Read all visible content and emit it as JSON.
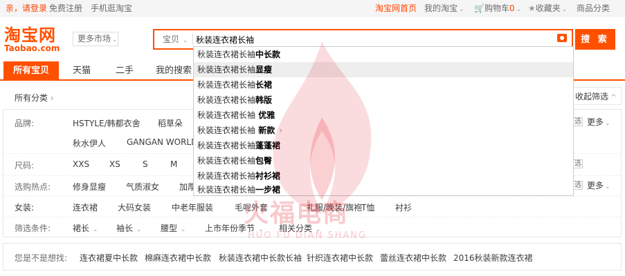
{
  "topbar": {
    "greeting": "亲，请登录",
    "register": "免费注册",
    "mobile": "手机逛淘宝",
    "home": "淘宝网首页",
    "my_taobao": "我的淘宝",
    "cart": "购物车",
    "cart_count": "0",
    "favorites": "收藏夹",
    "categories": "商品分类"
  },
  "logo": {
    "cn": "淘宝网",
    "en": "Taobao.com"
  },
  "more_market": "更多市场",
  "search": {
    "scope": "宝贝",
    "value": "秋装连衣裙长袖",
    "button": "搜 索"
  },
  "suggestions": [
    {
      "prefix": "秋装连衣裙长袖",
      "suffix": "中长款",
      "arrow": false
    },
    {
      "prefix": "秋装连衣裙长袖",
      "suffix": "显瘦",
      "arrow": false
    },
    {
      "prefix": "秋装连衣裙长袖",
      "suffix": "长裙",
      "arrow": false
    },
    {
      "prefix": "秋装连衣裙长袖",
      "suffix": "韩版",
      "arrow": false
    },
    {
      "prefix": "秋装连衣裙长袖",
      "suffix": " 优雅",
      "arrow": false
    },
    {
      "prefix": "秋装连衣裙长袖",
      "suffix": " 新款",
      "arrow": true
    },
    {
      "prefix": "秋装连衣裙长袖",
      "suffix": "蓬蓬裙",
      "arrow": false
    },
    {
      "prefix": "秋装连衣裙长袖",
      "suffix": "包臀",
      "arrow": false
    },
    {
      "prefix": "秋装连衣裙长袖",
      "suffix": "衬衫裙",
      "arrow": false
    },
    {
      "prefix": "秋装连衣裙长袖",
      "suffix": "一步裙",
      "arrow": false
    }
  ],
  "tabs": [
    "所有宝贝",
    "天猫",
    "二手",
    "我的搜索"
  ],
  "breadcrumb": "所有分类",
  "collapse": "收起筛选",
  "filters": {
    "brand_label": "品牌:",
    "brands_row1": [
      "HSTYLE/韩都衣舍",
      "稻草朵"
    ],
    "brands_row2": [
      "秋水伊人",
      "GANGAN WORLD/l"
    ],
    "size_label": "尺码:",
    "sizes": [
      "XXS",
      "XS",
      "S",
      "M"
    ],
    "hot_label": "选购热点:",
    "hots": [
      "修身显瘦",
      "气质淑女",
      "加厚"
    ],
    "women_label": "女装:",
    "women": [
      "连衣裙",
      "大码女装",
      "中老年服装",
      "毛呢外套",
      "礼服/晚装/旗袍",
      "T恤",
      "衬衫"
    ],
    "cond_label": "筛选条件:",
    "conds": [
      "裙长",
      "袖长",
      "腰型",
      "上市年份季节",
      "相关分类"
    ],
    "multi": "选",
    "more": "更多"
  },
  "related": {
    "label": "您是不是想找:",
    "items": [
      "连衣裙夏中长款",
      "棉麻连衣裙中长款",
      "秋装连衣裙中长款长袖",
      "针织连衣裙中长款",
      "蕾丝连衣裙中长款",
      "2016秋装新款连衣裙"
    ]
  },
  "watermark": {
    "title": "火福电商",
    "sub": "HUO FU DIAN SHANG"
  },
  "colors": {
    "accent": "#ff5000",
    "topbar_bg": "#f5f5f5"
  }
}
